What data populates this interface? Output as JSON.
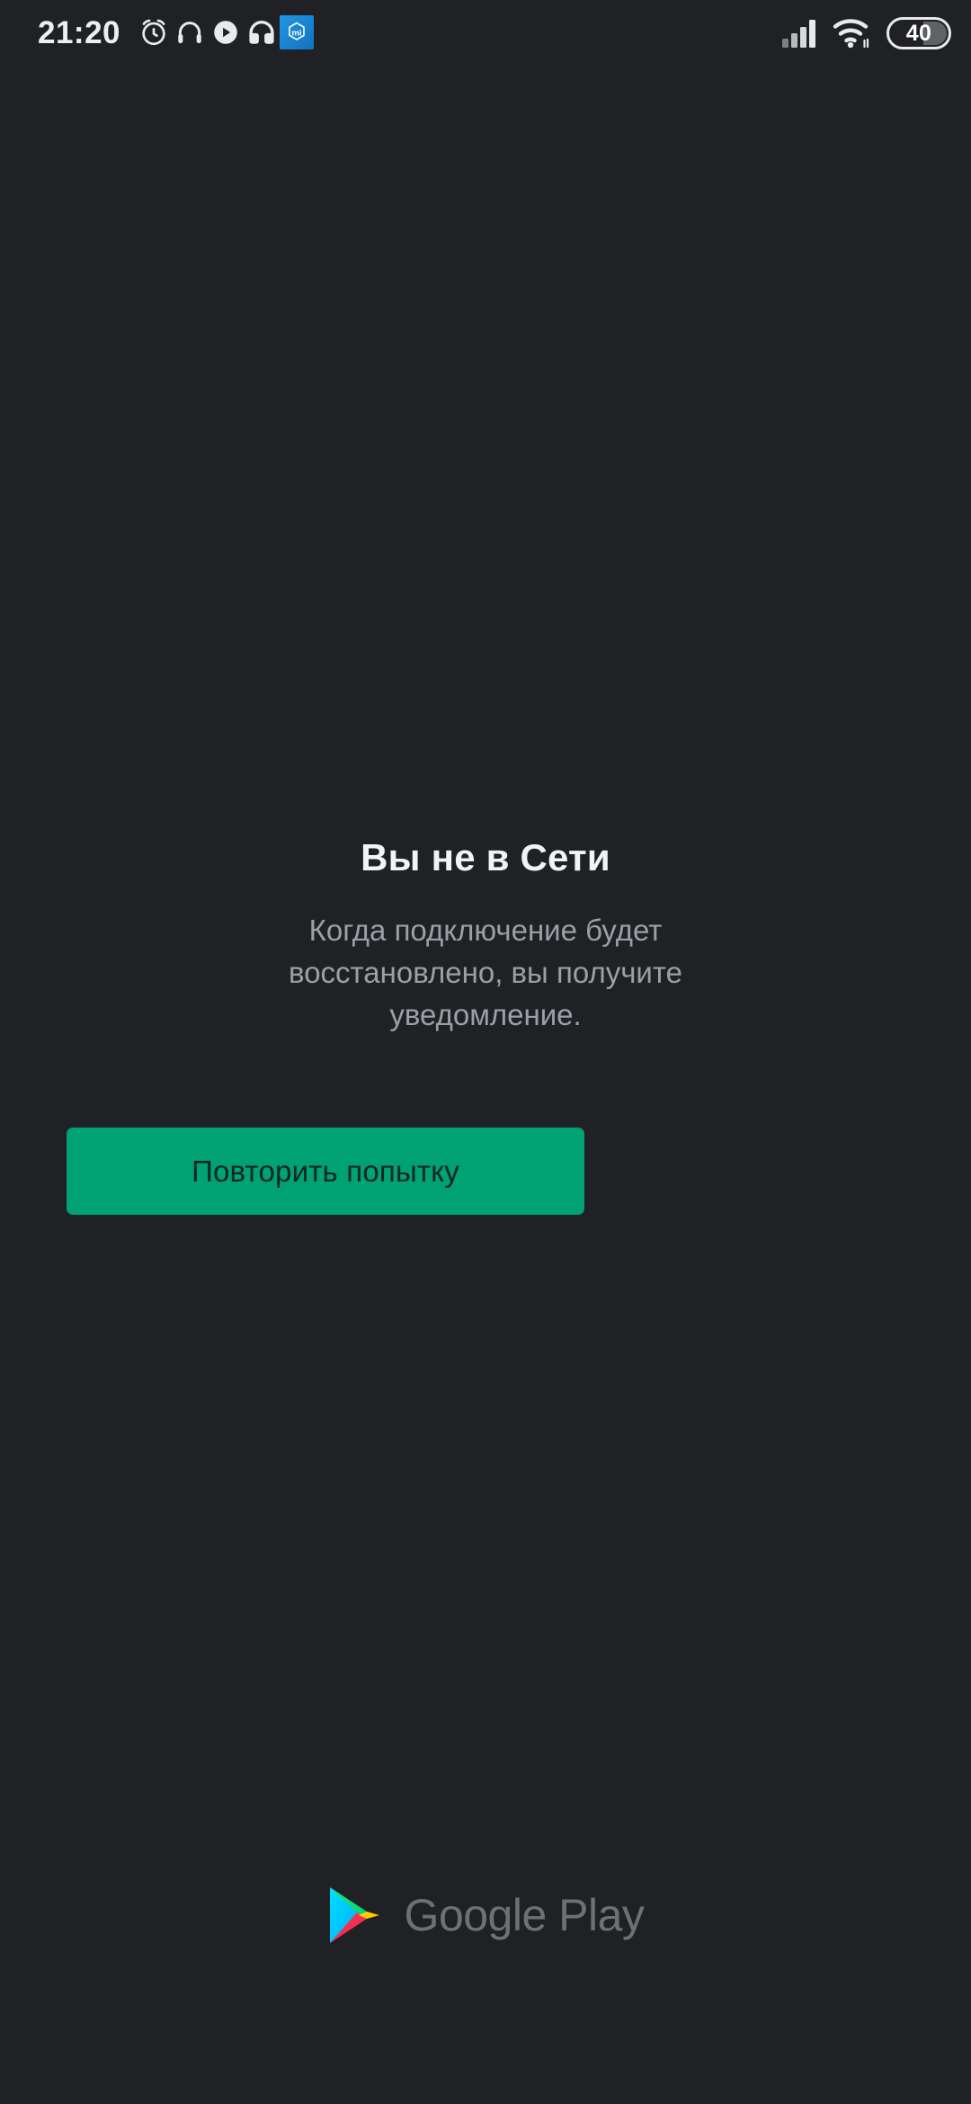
{
  "statusbar": {
    "time": "21:20",
    "left_icons": [
      {
        "name": "alarm-clock-icon",
        "label": "alarm"
      },
      {
        "name": "headset-icon",
        "label": "headset"
      },
      {
        "name": "music-play-icon",
        "label": "music playing"
      },
      {
        "name": "headphones-icon",
        "label": "headphones"
      },
      {
        "name": "mi-app-icon",
        "label": "mi"
      }
    ],
    "right_icons": [
      {
        "name": "cellular-signal-icon",
        "label": "signal"
      },
      {
        "name": "wifi-icon",
        "label": "wifi"
      }
    ],
    "battery": {
      "level_text": "40",
      "level_percent": 40
    },
    "colors": {
      "background": "#202124",
      "icon": "#e8eaed",
      "mi_badge": "#1a86d0"
    }
  },
  "main": {
    "headline": "Вы не в Сети",
    "subtext": "Когда подключение будет восстановлено, вы получите уведомление.",
    "retry_label": "Повторить попытку",
    "colors": {
      "headline": "#f1f3f4",
      "subtext": "#9aa0a6",
      "button_background": "#00A173",
      "button_text": "#10261f"
    }
  },
  "footer": {
    "wordmark": "Google Play",
    "logo_name": "google-play-triangle-icon",
    "colors": {
      "wordmark": "#6d7175",
      "logo_cyan": "#00D2FF",
      "logo_green": "#00E676",
      "logo_yellow": "#FFCE00",
      "logo_red": "#F5334F"
    }
  }
}
